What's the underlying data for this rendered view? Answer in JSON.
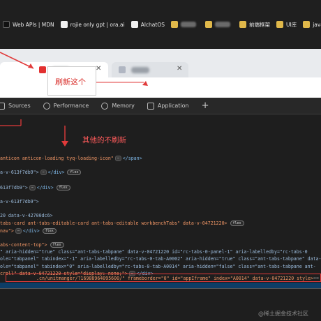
{
  "bookmarks": [
    {
      "icon": "mdn-icon",
      "label": "Web APIs | MDN"
    },
    {
      "icon": "openai-icon",
      "label": "rojie only gpt | ora.ai"
    },
    {
      "icon": "alchat-icon",
      "label": "AlchatOS"
    },
    {
      "icon": "folder-icon",
      "label": ""
    },
    {
      "icon": "folder-icon",
      "label": ""
    },
    {
      "icon": "folder-icon",
      "label": "前端框架"
    },
    {
      "icon": "folder-icon",
      "label": "UI库"
    },
    {
      "icon": "folder-icon",
      "label": "javas"
    }
  ],
  "annotations": {
    "refresh": "刷新这个",
    "others_no_refresh": "其他的不刷新"
  },
  "devtools_tabs": [
    {
      "icon": "sources-icon",
      "label": "Sources"
    },
    {
      "icon": "performance-icon",
      "label": "Performance"
    },
    {
      "icon": "memory-icon",
      "label": "Memory"
    },
    {
      "icon": "application-icon",
      "label": "Application"
    }
  ],
  "code": {
    "l1": {
      "a": "anticon anticon-loading tyq-loading-icon\"",
      "ph": "⋯",
      "b": "</span>"
    },
    "l2": {
      "a": "a-v-613f7db9\">",
      "ph": "⋯",
      "b": "</div>",
      "badge": "flex"
    },
    "l3": {
      "a": "613f7db9\">",
      "ph": "⋯",
      "b": "</div>",
      "badge": "flex"
    },
    "l4": {
      "a": "a-v-613f7db9\">"
    },
    "l5": {
      "a": "20 data-v-42700dc6>"
    },
    "l6": {
      "a": "tabs-card ant-tabs-editable-card ant-tabs-editable workbenchTabs\" data-v-04721220>",
      "badge": "flex"
    },
    "l7": {
      "a": "nav\">",
      "ph": "⋯",
      "b": "</div>",
      "badge": "flex"
    },
    "l8": {
      "a": "abs-content-top\">",
      "badge": "flex"
    },
    "l9": {
      "a": "\" aria-hidden=\"true\" class=\"ant-tabs-tabpane\" data-v-04721220 id=\"rc-tabs-0-panel-1\" aria-labelledby=\"rc-tabs-0"
    },
    "l10": {
      "a": "ole=\"tabpanel\" tabindex=\"-1\" aria-labelledby=\"rc-tabs-0-tab-A0002\" aria-hidden=\"true\" class=\"ant-tabs-tabpane\" data-v"
    },
    "l11": {
      "a": "ole=\"tabpanel\" tabindex=\"0\" aria-labelledby=\"rc-tabs-0-tab-A0014\" aria-hidden=\"false\" class=\"ant-tabs-tabpane ant-"
    },
    "l12": {
      "a": "croll\" data-v-04721220 style=\"display: none;\">",
      "ph": "⋯",
      "b": "</div>"
    },
    "l13": {
      "a": ".cn/unitmanger/?16988964095600/\" frameborder=\"0\" id=\"appIframe\" index=\"A0014\" data-v-04721220 style>",
      "tail": "== $0"
    }
  },
  "watermark": "@稀土掘金技术社区",
  "colors": {
    "annotation_red": "#e13a3a",
    "devtools_bg": "#1e1e1e",
    "tag_blue": "#7eb8e8",
    "attr_value": "#f29766"
  }
}
